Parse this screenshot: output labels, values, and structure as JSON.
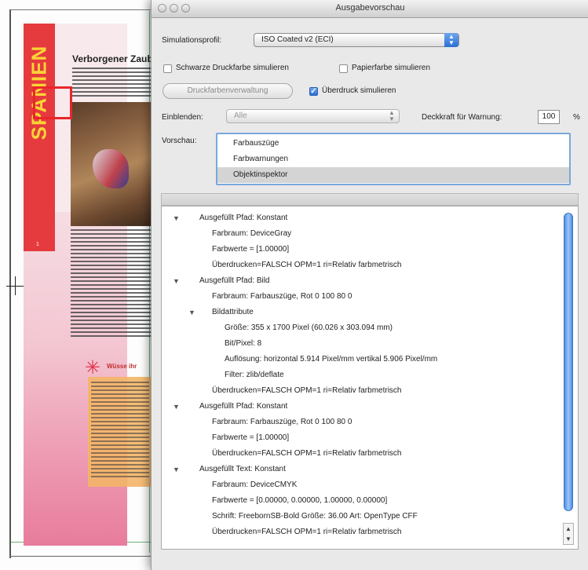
{
  "window": {
    "title": "Ausgabevorschau"
  },
  "simulation": {
    "profile_label": "Simulationsprofil:",
    "profile_value": "ISO Coated v2 (ECI)",
    "black_ink_label": "Schwarze Druckfarbe simulieren",
    "paper_color_label": "Papierfarbe simulieren",
    "ink_manager_label": "Druckfarbenverwaltung",
    "overprint_label": "Überdruck simulieren",
    "overprint_checked": true
  },
  "show": {
    "label": "Einblenden:",
    "value": "Alle",
    "opacity_label": "Deckkraft für Warnung:",
    "opacity_value": "100",
    "opacity_unit": "%"
  },
  "preview": {
    "label": "Vorschau:",
    "items": [
      {
        "label": "Farbauszüge",
        "selected": false
      },
      {
        "label": "Farbwarnungen",
        "selected": false
      },
      {
        "label": "Objektinspektor",
        "selected": true
      }
    ]
  },
  "inspector": {
    "rows": [
      {
        "text": "Ausgefüllt Pfad: Konstant",
        "level": 0,
        "expanded": true
      },
      {
        "text": "Farbraum: DeviceGray",
        "level": 1
      },
      {
        "text": "Farbwerte = [1.00000]",
        "level": 1
      },
      {
        "text": "Überdrucken=FALSCH OPM=1 ri=Relativ farbmetrisch",
        "level": 1
      },
      {
        "text": "Ausgefüllt Pfad: Bild",
        "level": 0,
        "expanded": true
      },
      {
        "text": "Farbraum: Farbauszüge, Rot 0 100 80 0",
        "level": 1
      },
      {
        "text": "Bildattribute",
        "level": 1,
        "expanded": true
      },
      {
        "text": "Größe: 355 x 1700 Pixel (60.026 x 303.094 mm)",
        "level": 2
      },
      {
        "text": "Bit/Pixel: 8",
        "level": 2
      },
      {
        "text": "Auflösung: horizontal 5.914 Pixel/mm vertikal 5.906 Pixel/mm",
        "level": 2
      },
      {
        "text": "Filter: zlib/deflate",
        "level": 2
      },
      {
        "text": "Überdrucken=FALSCH OPM=1 ri=Relativ farbmetrisch",
        "level": 1
      },
      {
        "text": "Ausgefüllt Pfad: Konstant",
        "level": 0,
        "expanded": true
      },
      {
        "text": "Farbraum: Farbauszüge, Rot 0 100 80 0",
        "level": 1
      },
      {
        "text": "Farbwerte = [1.00000]",
        "level": 1
      },
      {
        "text": "Überdrucken=FALSCH OPM=1 ri=Relativ farbmetrisch",
        "level": 1
      },
      {
        "text": "Ausgefüllt Text: Konstant",
        "level": 0,
        "expanded": true
      },
      {
        "text": "Farbraum: DeviceCMYK",
        "level": 1
      },
      {
        "text": "Farbwerte = [0.00000, 0.00000, 1.00000, 0.00000]",
        "level": 1
      },
      {
        "text": "Schrift: FreebornSB-Bold Größe: 36.00 Art: OpenType CFF",
        "level": 1
      },
      {
        "text": "Überdrucken=FALSCH OPM=1 ri=Relativ farbmetrisch",
        "level": 1
      }
    ]
  },
  "document": {
    "band_text": "SPANIEN",
    "heading": "Verborgener Zaub",
    "box_title": "Wüsse ihr",
    "page_number": "1"
  },
  "colors": {
    "accent_blue": "#2b6fd6",
    "band_red": "#e53a3e",
    "band_text_yellow": "#fbd436",
    "highlight_red": "#e8262b"
  }
}
